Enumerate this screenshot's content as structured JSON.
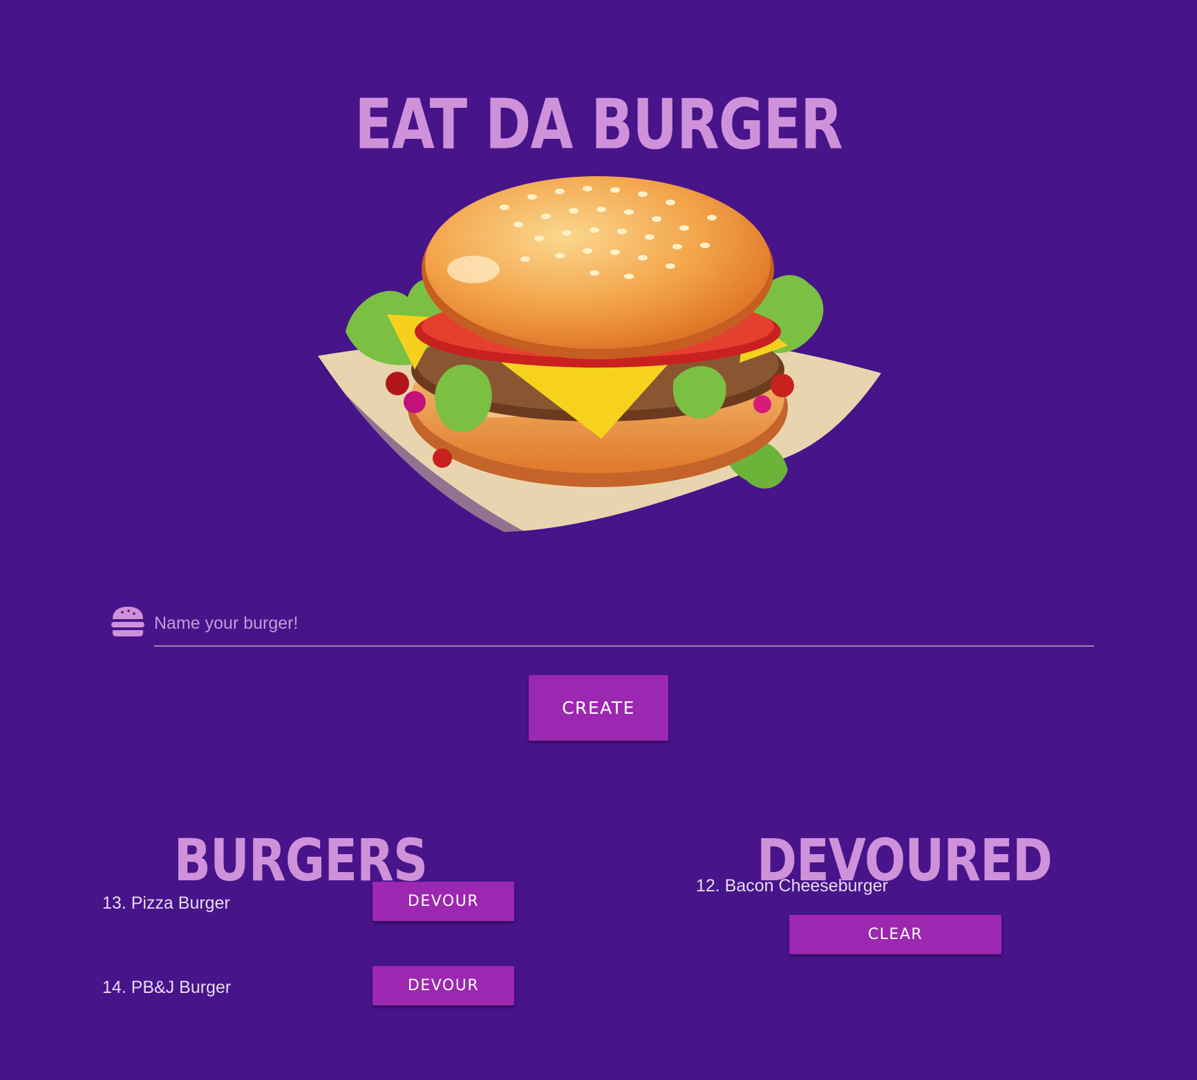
{
  "header": {
    "title": "Eat Da Burger"
  },
  "form": {
    "placeholder": "Name your burger!",
    "value": "",
    "icon": "hamburger-icon",
    "submit_label": "Create"
  },
  "sections": {
    "burgers": {
      "title": "Burgers",
      "items": [
        {
          "label": "13. Pizza Burger",
          "action": "Devour"
        },
        {
          "label": "14. PB&J Burger",
          "action": "Devour"
        }
      ]
    },
    "devoured": {
      "title": "Devoured",
      "items": [
        {
          "label": "12. Bacon Cheeseburger",
          "action": "Clear"
        }
      ]
    }
  },
  "colors": {
    "background": "#47148a",
    "accent": "#9c27b0",
    "heading": "#cf92da",
    "text": "#e6dcf2"
  }
}
